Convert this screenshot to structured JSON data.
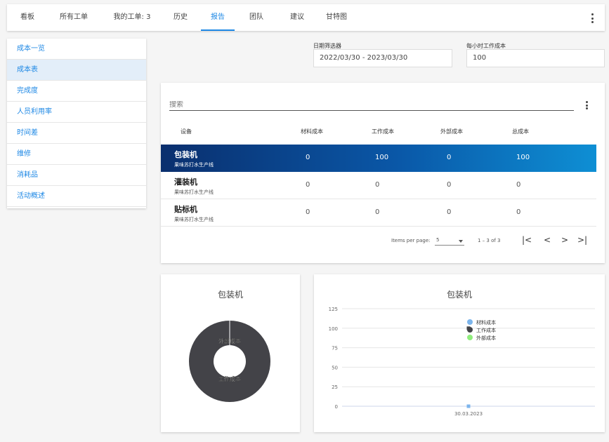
{
  "nav": {
    "tabs": [
      "看板",
      "所有工单",
      "我的工单: 3",
      "历史",
      "报告",
      "团队",
      "建议",
      "甘特图"
    ],
    "active_tab": "报告"
  },
  "sidebar": {
    "items": [
      "成本一览",
      "成本表",
      "完成度",
      "人员利用率",
      "时间差",
      "维修",
      "消耗品",
      "活动概述"
    ],
    "active_item": "成本表"
  },
  "filters": {
    "date_label": "日期筛选器",
    "date_value": "2022/03/30 - 2023/03/30",
    "hourly_label": "每小时工作成本",
    "hourly_value": "100"
  },
  "table": {
    "search_placeholder": "搜索",
    "columns": [
      "设备",
      "材料成本",
      "工作成本",
      "外部成本",
      "总成本"
    ],
    "rows": [
      {
        "name": "包装机",
        "sub": "果味苏打水生产线",
        "material": "0",
        "work": "100",
        "external": "0",
        "total": "100",
        "selected": true
      },
      {
        "name": "灌装机",
        "sub": "果味苏打水生产线",
        "material": "0",
        "work": "0",
        "external": "0",
        "total": "0",
        "selected": false
      },
      {
        "name": "贴标机",
        "sub": "果味苏打水生产线",
        "material": "0",
        "work": "0",
        "external": "0",
        "total": "0",
        "selected": false
      }
    ],
    "paginator": {
      "label": "Items per page:",
      "page_size": "5",
      "range": "1 – 3 of 3",
      "first": "|<",
      "prev": "<",
      "next": ">",
      "last": ">|"
    }
  },
  "colors": {
    "accent": "#1e88e5",
    "row_gradient_start": "#0a2f6e",
    "row_gradient_end": "#0e8fd4",
    "material": "#7cb5ec",
    "work": "#434348",
    "external": "#90ed7d"
  },
  "chart_data": [
    {
      "type": "pie",
      "title": "包装机",
      "labels": [
        "外部成本",
        "工作成本"
      ],
      "values": [
        0,
        100
      ],
      "legend": "none"
    },
    {
      "type": "scatter",
      "title": "包装机",
      "x": [
        "30.03.2023"
      ],
      "series": [
        {
          "name": "材料成本",
          "values": [
            0
          ]
        },
        {
          "name": "工作成本",
          "values": [
            100
          ]
        },
        {
          "name": "外部成本",
          "values": [
            0
          ]
        }
      ],
      "yticks": [
        "0",
        "25",
        "50",
        "75",
        "100",
        "125"
      ],
      "ylim": [
        0,
        125
      ],
      "grid": true,
      "legend": "top-center"
    }
  ]
}
